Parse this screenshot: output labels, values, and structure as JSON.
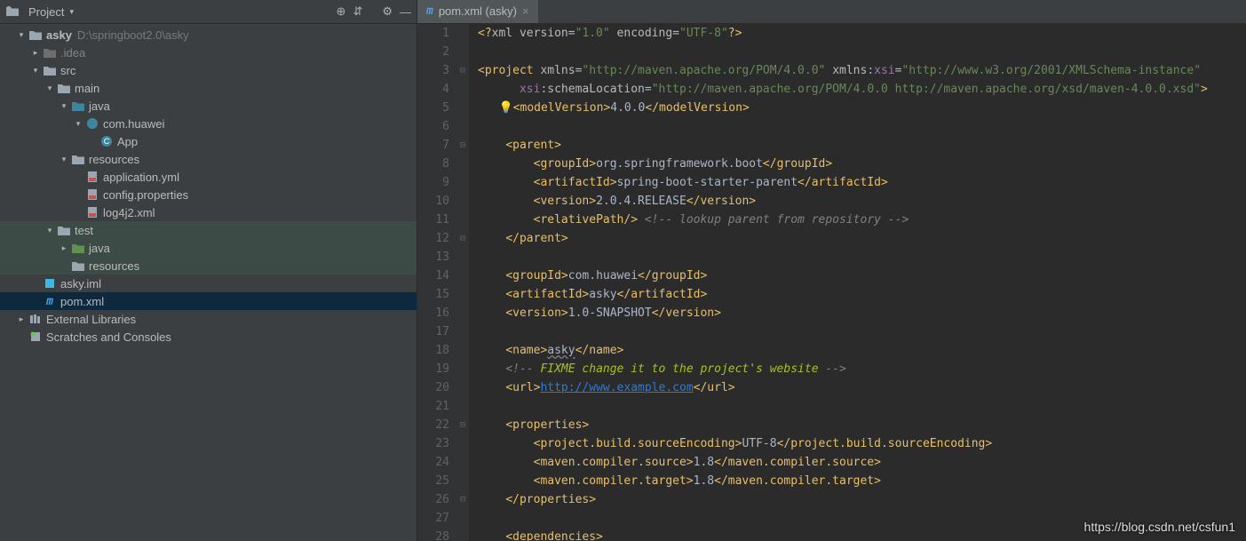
{
  "panel": {
    "title": "Project",
    "dropdown": "▾",
    "actions": {
      "target": "⊕",
      "collapse": "⇵",
      "settings": "⚙",
      "hide": "—"
    }
  },
  "tree": [
    {
      "depth": 0,
      "arrow": "▾",
      "icon": "root",
      "label": "asky",
      "path": "D:\\springboot2.0\\asky",
      "bold": true
    },
    {
      "depth": 1,
      "arrow": "▸",
      "icon": "folder-muted",
      "label": ".idea",
      "muted": true
    },
    {
      "depth": 1,
      "arrow": "▾",
      "icon": "folder",
      "label": "src"
    },
    {
      "depth": 2,
      "arrow": "▾",
      "icon": "folder",
      "label": "main"
    },
    {
      "depth": 3,
      "arrow": "▾",
      "icon": "folder-blue",
      "label": "java"
    },
    {
      "depth": 4,
      "arrow": "▾",
      "icon": "package",
      "label": "com.huawei"
    },
    {
      "depth": 5,
      "arrow": "",
      "icon": "class",
      "label": "App"
    },
    {
      "depth": 3,
      "arrow": "▾",
      "icon": "folder-res",
      "label": "resources"
    },
    {
      "depth": 4,
      "arrow": "",
      "icon": "yml",
      "label": "application.yml"
    },
    {
      "depth": 4,
      "arrow": "",
      "icon": "prop",
      "label": "config.properties"
    },
    {
      "depth": 4,
      "arrow": "",
      "icon": "xml",
      "label": "log4j2.xml"
    },
    {
      "depth": 2,
      "arrow": "▾",
      "icon": "folder-test",
      "label": "test",
      "hl": true
    },
    {
      "depth": 3,
      "arrow": "▸",
      "icon": "folder-green",
      "label": "java",
      "hl": true
    },
    {
      "depth": 3,
      "arrow": "",
      "icon": "folder",
      "label": "resources",
      "hl": true
    },
    {
      "depth": 1,
      "arrow": "",
      "icon": "iml",
      "label": "asky.iml"
    },
    {
      "depth": 1,
      "arrow": "",
      "icon": "maven",
      "label": "pom.xml",
      "selected": true
    },
    {
      "depth": 0,
      "arrow": "▸",
      "icon": "lib",
      "label": "External Libraries"
    },
    {
      "depth": 0,
      "arrow": "",
      "icon": "scratch",
      "label": "Scratches and Consoles"
    }
  ],
  "tab": {
    "icon": "m",
    "label": "pom.xml (asky)",
    "close": "×"
  },
  "code_lines": [
    {
      "n": 1,
      "fold": "",
      "l": 0,
      "seg": [
        [
          "tag",
          "<?"
        ],
        [
          "attr",
          "xml version"
        ],
        [
          "text",
          "="
        ],
        [
          "str",
          "\"1.0\""
        ],
        [
          "text",
          " "
        ],
        [
          "attr",
          "encoding"
        ],
        [
          "text",
          "="
        ],
        [
          "str",
          "\"UTF-8\""
        ],
        [
          "tag",
          "?>"
        ]
      ]
    },
    {
      "n": 2,
      "fold": "",
      "l": 0,
      "seg": []
    },
    {
      "n": 3,
      "fold": "⊟",
      "l": 0,
      "seg": [
        [
          "tag",
          "<project "
        ],
        [
          "attr",
          "xmlns"
        ],
        [
          "text",
          "="
        ],
        [
          "str",
          "\"http://maven.apache.org/POM/4.0.0\""
        ],
        [
          "text",
          " "
        ],
        [
          "attr",
          "xmlns"
        ],
        [
          "text",
          ":"
        ],
        [
          "attr-ns",
          "xsi"
        ],
        [
          "text",
          "="
        ],
        [
          "str",
          "\"http://www.w3.org/2001/XMLSchema-instance\""
        ]
      ]
    },
    {
      "n": 4,
      "fold": "",
      "l": 1,
      "pre": "  ",
      "seg": [
        [
          "attr-ns",
          "xsi"
        ],
        [
          "text",
          ":"
        ],
        [
          "attr",
          "schemaLocation"
        ],
        [
          "text",
          "="
        ],
        [
          "str",
          "\"http://maven.apache.org/POM/4.0.0 http://maven.apache.org/xsd/maven-4.0.0.xsd\""
        ],
        [
          "tag",
          ">"
        ]
      ]
    },
    {
      "n": 5,
      "fold": "",
      "l": 1,
      "bulb": true,
      "seg": [
        [
          "tag",
          "<modelVersion>"
        ],
        [
          "text",
          "4.0.0"
        ],
        [
          "tag",
          "</modelVersion>"
        ]
      ]
    },
    {
      "n": 6,
      "fold": "",
      "l": 1,
      "seg": []
    },
    {
      "n": 7,
      "fold": "⊟",
      "l": 1,
      "seg": [
        [
          "tag",
          "<parent>"
        ]
      ]
    },
    {
      "n": 8,
      "fold": "",
      "l": 2,
      "seg": [
        [
          "tag",
          "<groupId>"
        ],
        [
          "text",
          "org.springframework.boot"
        ],
        [
          "tag",
          "</groupId>"
        ]
      ]
    },
    {
      "n": 9,
      "fold": "",
      "l": 2,
      "seg": [
        [
          "tag",
          "<artifactId>"
        ],
        [
          "text",
          "spring-boot-starter-parent"
        ],
        [
          "tag",
          "</artifactId>"
        ]
      ]
    },
    {
      "n": 10,
      "fold": "",
      "l": 2,
      "seg": [
        [
          "tag",
          "<version>"
        ],
        [
          "text",
          "2.0.4.RELEASE"
        ],
        [
          "tag",
          "</version>"
        ]
      ]
    },
    {
      "n": 11,
      "fold": "",
      "l": 2,
      "seg": [
        [
          "tag",
          "<relativePath/>"
        ],
        [
          "text",
          " "
        ],
        [
          "comment",
          "<!-- lookup parent from repository -->"
        ]
      ]
    },
    {
      "n": 12,
      "fold": "⊟",
      "l": 1,
      "seg": [
        [
          "tag",
          "</parent>"
        ]
      ]
    },
    {
      "n": 13,
      "fold": "",
      "l": 1,
      "seg": []
    },
    {
      "n": 14,
      "fold": "",
      "l": 1,
      "seg": [
        [
          "tag",
          "<groupId>"
        ],
        [
          "text",
          "com.huawei"
        ],
        [
          "tag",
          "</groupId>"
        ]
      ]
    },
    {
      "n": 15,
      "fold": "",
      "l": 1,
      "seg": [
        [
          "tag",
          "<artifactId>"
        ],
        [
          "text",
          "asky"
        ],
        [
          "tag",
          "</artifactId>"
        ]
      ]
    },
    {
      "n": 16,
      "fold": "",
      "l": 1,
      "seg": [
        [
          "tag",
          "<version>"
        ],
        [
          "text",
          "1.0-SNAPSHOT"
        ],
        [
          "tag",
          "</version>"
        ]
      ]
    },
    {
      "n": 17,
      "fold": "",
      "l": 1,
      "seg": []
    },
    {
      "n": 18,
      "fold": "",
      "l": 1,
      "seg": [
        [
          "tag",
          "<name>"
        ],
        [
          "text-wavy",
          "asky"
        ],
        [
          "tag",
          "</name>"
        ]
      ]
    },
    {
      "n": 19,
      "fold": "",
      "l": 1,
      "seg": [
        [
          "comment",
          "<!-- "
        ],
        [
          "comment-fix",
          "FIXME change it to the project's website"
        ],
        [
          "comment",
          " -->"
        ]
      ]
    },
    {
      "n": 20,
      "fold": "",
      "l": 1,
      "seg": [
        [
          "tag",
          "<url>"
        ],
        [
          "link",
          "http://www.example.com"
        ],
        [
          "tag",
          "</url>"
        ]
      ]
    },
    {
      "n": 21,
      "fold": "",
      "l": 1,
      "seg": []
    },
    {
      "n": 22,
      "fold": "⊟",
      "l": 1,
      "seg": [
        [
          "tag",
          "<properties>"
        ]
      ]
    },
    {
      "n": 23,
      "fold": "",
      "l": 2,
      "seg": [
        [
          "tag",
          "<project.build.sourceEncoding>"
        ],
        [
          "text",
          "UTF-8"
        ],
        [
          "tag",
          "</project.build.sourceEncoding>"
        ]
      ]
    },
    {
      "n": 24,
      "fold": "",
      "l": 2,
      "seg": [
        [
          "tag",
          "<maven.compiler.source>"
        ],
        [
          "text",
          "1.8"
        ],
        [
          "tag",
          "</maven.compiler.source>"
        ]
      ]
    },
    {
      "n": 25,
      "fold": "",
      "l": 2,
      "seg": [
        [
          "tag",
          "<maven.compiler.target>"
        ],
        [
          "text",
          "1.8"
        ],
        [
          "tag",
          "</maven.compiler.target>"
        ]
      ]
    },
    {
      "n": 26,
      "fold": "⊟",
      "l": 1,
      "seg": [
        [
          "tag",
          "</properties>"
        ]
      ]
    },
    {
      "n": 27,
      "fold": "",
      "l": 1,
      "seg": []
    },
    {
      "n": 28,
      "fold": "",
      "l": 1,
      "seg": [
        [
          "tag",
          "<dependencies>"
        ]
      ]
    }
  ],
  "watermark": "https://blog.csdn.net/csfun1"
}
